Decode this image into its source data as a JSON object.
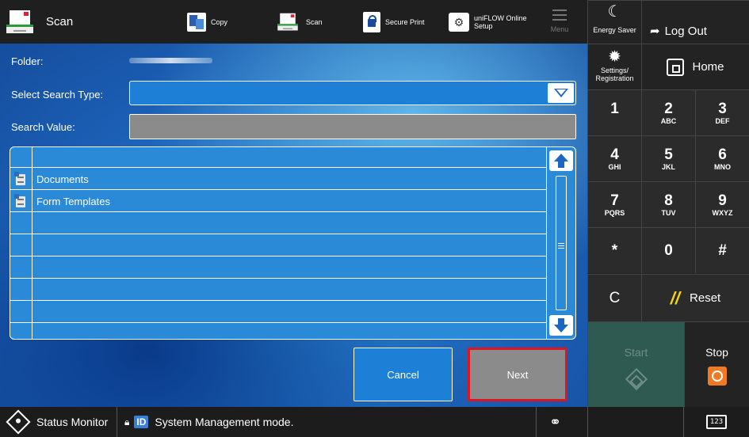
{
  "topbar": {
    "title": "Scan",
    "buttons": [
      {
        "label": "Copy",
        "icon": "copy-icon"
      },
      {
        "label": "Scan",
        "icon": "scan-icon"
      },
      {
        "label": "Secure Print",
        "icon": "lock-icon"
      },
      {
        "label": "uniFLOW Online Setup",
        "icon": "uniflow-icon"
      }
    ],
    "menu_label": "Menu"
  },
  "form": {
    "folder_label": "Folder:",
    "search_type_label": "Select Search Type:",
    "search_value_label": "Search Value:"
  },
  "list": {
    "rows": [
      {
        "label": "Documents",
        "icon": "cabinet-icon"
      },
      {
        "label": "Form Templates",
        "icon": "cabinet-icon"
      }
    ]
  },
  "actions": {
    "cancel": "Cancel",
    "next": "Next"
  },
  "panel": {
    "energy_saver": "Energy Saver",
    "log_out": "Log Out",
    "settings_line1": "Settings/",
    "settings_line2": "Registration",
    "home": "Home",
    "keys": [
      {
        "main": "1",
        "sub": ""
      },
      {
        "main": "2",
        "sub": "ABC"
      },
      {
        "main": "3",
        "sub": "DEF"
      },
      {
        "main": "4",
        "sub": "GHI"
      },
      {
        "main": "5",
        "sub": "JKL"
      },
      {
        "main": "6",
        "sub": "MNO"
      },
      {
        "main": "7",
        "sub": "PQRS"
      },
      {
        "main": "8",
        "sub": "TUV"
      },
      {
        "main": "9",
        "sub": "WXYZ"
      },
      {
        "main": "*",
        "sub": ""
      },
      {
        "main": "0",
        "sub": ""
      },
      {
        "main": "#",
        "sub": ""
      }
    ],
    "clear": "C",
    "reset": "Reset",
    "start": "Start",
    "stop": "Stop"
  },
  "statusbar": {
    "status_monitor": "Status Monitor",
    "id_badge": "ID",
    "message": "System Management mode.",
    "keyboard_label": "123"
  }
}
